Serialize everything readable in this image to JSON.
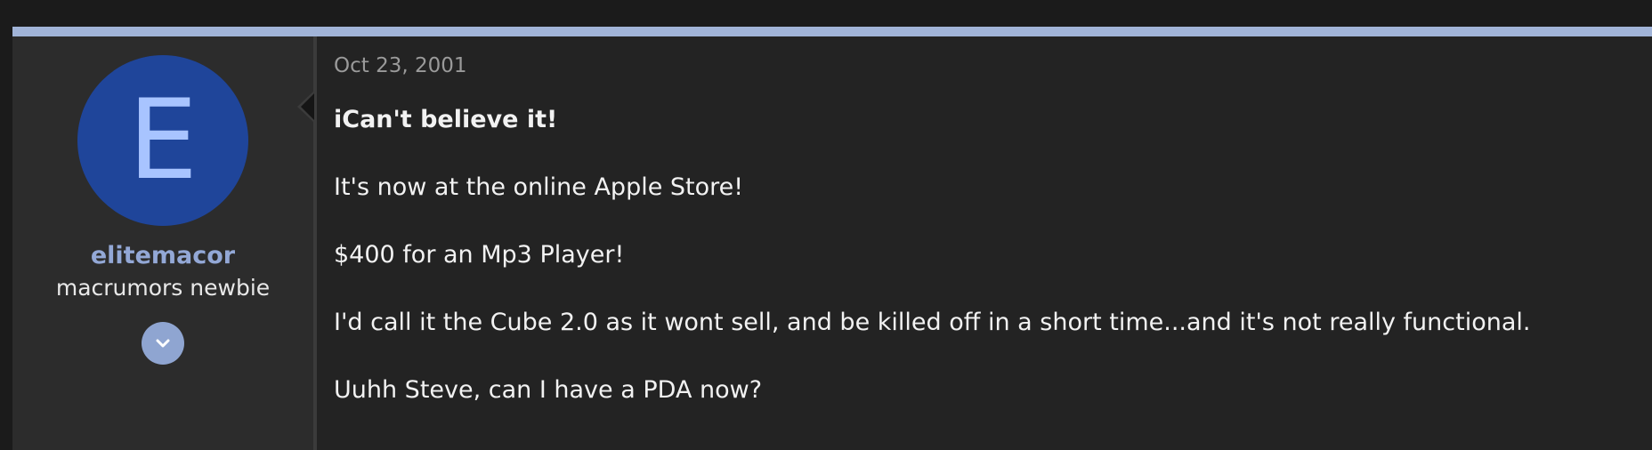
{
  "post": {
    "accent_color": "#a1b4d8",
    "user": {
      "avatar_letter": "E",
      "avatar_color": "#1f459a",
      "username": "elitemacor",
      "title": "macrumors newbie",
      "expand_icon": "chevron-down-icon"
    },
    "date": "Oct 23, 2001",
    "message": {
      "headline": "iCan't believe it!",
      "paragraphs": [
        "It's now at the online Apple Store!",
        "$400 for an Mp3 Player!",
        "I'd call it the Cube 2.0 as it wont sell, and be killed off in a short time...and it's not really functional.",
        "Uuhh Steve, can I have a PDA now?"
      ]
    }
  }
}
